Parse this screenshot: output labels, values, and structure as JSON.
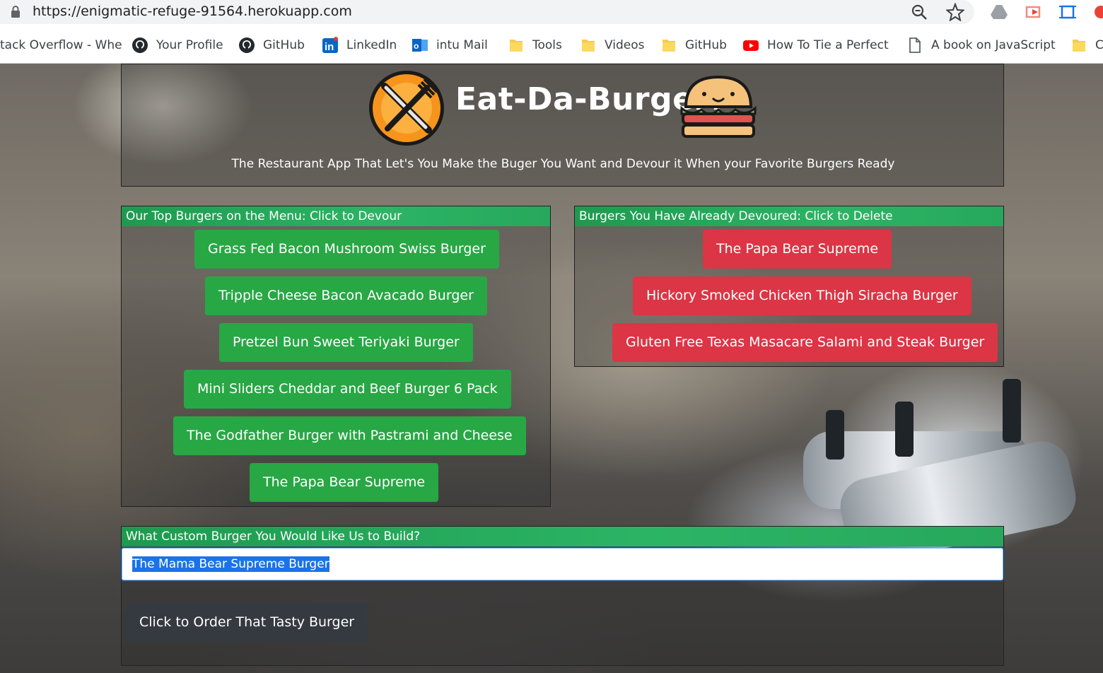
{
  "browser": {
    "url": "https://enigmatic-refuge-91564.herokuapp.com",
    "bookmarks": [
      {
        "label": "tack Overflow - Whe",
        "icon": "stackoverflow-icon"
      },
      {
        "label": "Your Profile",
        "icon": "github-icon"
      },
      {
        "label": "GitHub",
        "icon": "github-icon"
      },
      {
        "label": "LinkedIn",
        "icon": "linkedin-icon"
      },
      {
        "label": "intu Mail",
        "icon": "outlook-icon"
      },
      {
        "label": "Tools",
        "icon": "folder-icon"
      },
      {
        "label": "Videos",
        "icon": "folder-icon"
      },
      {
        "label": "GitHub",
        "icon": "folder-icon"
      },
      {
        "label": "How To Tie a Perfect",
        "icon": "youtube-icon"
      },
      {
        "label": "A book on JavaScript",
        "icon": "document-icon"
      },
      {
        "label": "C",
        "icon": "folder-icon"
      }
    ]
  },
  "header": {
    "title": "Eat-Da-Burger!",
    "tagline": "The Restaurant App That Let's You Make the Buger You Want and Devour it When your Favorite Burgers Ready"
  },
  "menu": {
    "heading": "Our Top Burgers on the Menu: Click to Devour",
    "items": [
      "Grass Fed Bacon Mushroom Swiss Burger",
      "Tripple Cheese Bacon Avacado Burger",
      "Pretzel Bun Sweet Teriyaki Burger",
      "Mini Sliders Cheddar and Beef Burger 6 Pack",
      "The Godfather Burger with Pastrami and Cheese",
      "The Papa Bear Supreme"
    ]
  },
  "devoured": {
    "heading": "Burgers You Have Already Devoured: Click to Delete",
    "items": [
      "The Papa Bear Supreme",
      "Hickory Smoked Chicken Thigh Siracha Burger",
      "Gluten Free Texas Masacare Salami and Steak Burger"
    ]
  },
  "order": {
    "heading": "What Custom Burger You Would Like Us to Build?",
    "input_value": "The Mama Bear Supreme Burger",
    "submit_label": "Click to Order That Tasty Burger"
  },
  "colors": {
    "green": "#28a745",
    "red": "#dc3545",
    "dark": "#343a40",
    "header_green": "#2cb465"
  }
}
